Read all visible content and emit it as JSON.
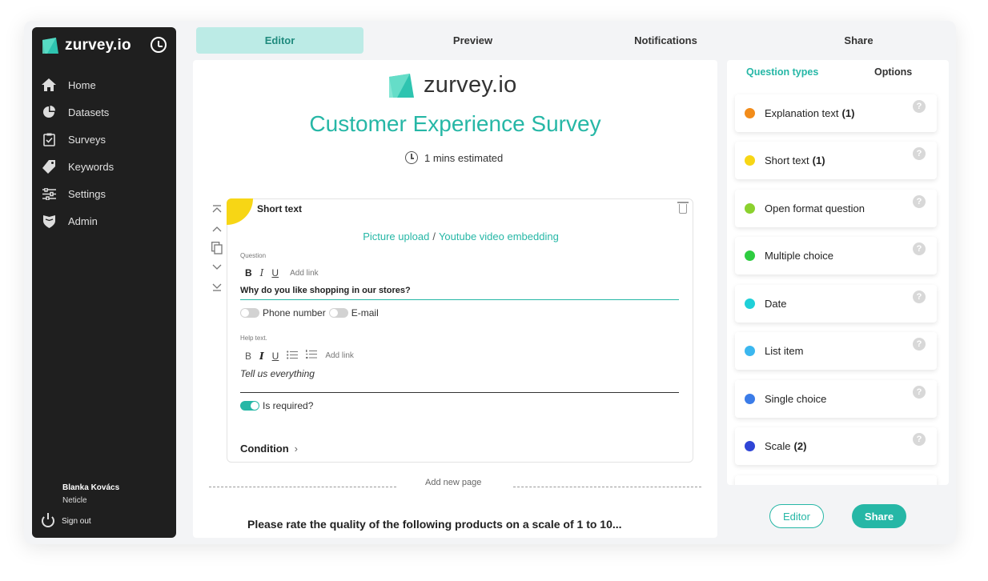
{
  "app": {
    "name": "zurvey.io",
    "brand_color": "#26b7a6"
  },
  "sidebar": {
    "items": [
      {
        "label": "Home",
        "icon": "home-icon"
      },
      {
        "label": "Datasets",
        "icon": "pie-chart-icon"
      },
      {
        "label": "Surveys",
        "icon": "clipboard-check-icon"
      },
      {
        "label": "Keywords",
        "icon": "tag-icon"
      },
      {
        "label": "Settings",
        "icon": "sliders-icon"
      },
      {
        "label": "Admin",
        "icon": "shield-icon"
      }
    ],
    "user": {
      "name": "Blanka Kovács",
      "org": "Neticle"
    },
    "sign_out": "Sign out"
  },
  "tabs": [
    "Editor",
    "Preview",
    "Notifications",
    "Share"
  ],
  "main": {
    "brand": "zurvey.io",
    "title": "Customer Experience Survey",
    "estimate": "1 mins estimated",
    "card": {
      "type": "Short text",
      "picture_upload": "Picture upload",
      "separator": "/",
      "youtube": "Youtube video embedding",
      "question_label": "Question",
      "bold": "B",
      "italic": "I",
      "underline": "U",
      "add_link": "Add link",
      "question": "Why do you like shopping in our stores?",
      "phone": "Phone number",
      "email": "E-mail",
      "help_label": "Help text.",
      "help_text": "Tell us everything",
      "required": "Is required?",
      "condition": "Condition"
    },
    "add_page": "Add new page",
    "next_question": "Please rate the quality of the following products on a scale of 1 to 10..."
  },
  "right_panel": {
    "tabs": [
      "Question types",
      "Options"
    ],
    "types": [
      {
        "label": "Explanation text",
        "count": "(1)",
        "color": "#f28c1a"
      },
      {
        "label": "Short text",
        "count": "(1)",
        "color": "#f7d615"
      },
      {
        "label": "Open format question",
        "count": "",
        "color": "#8bd12e"
      },
      {
        "label": "Multiple choice",
        "count": "",
        "color": "#2ecc40"
      },
      {
        "label": "Date",
        "count": "",
        "color": "#1fd0d8"
      },
      {
        "label": "List item",
        "count": "",
        "color": "#3bb7ef"
      },
      {
        "label": "Single choice",
        "count": "",
        "color": "#3b7ce8"
      },
      {
        "label": "Scale",
        "count": "(2)",
        "color": "#2f45d6"
      }
    ],
    "help": "?"
  },
  "buttons": {
    "editor": "Editor",
    "share": "Share"
  }
}
